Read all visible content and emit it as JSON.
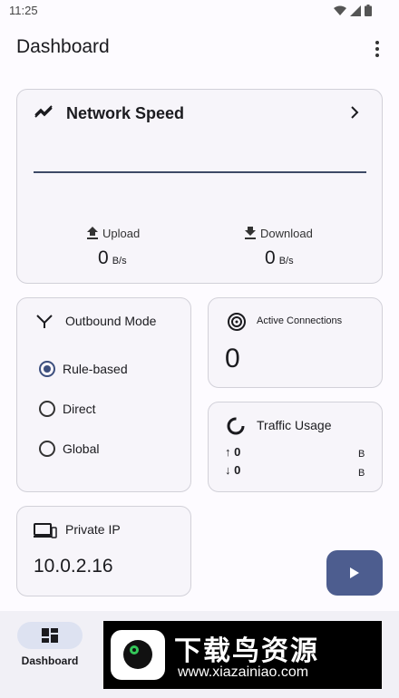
{
  "status": {
    "time": "11:25"
  },
  "appbar": {
    "title": "Dashboard"
  },
  "network_speed": {
    "title": "Network Speed",
    "upload_label": "Upload",
    "upload_value": "0",
    "upload_unit": "B/s",
    "download_label": "Download",
    "download_value": "0",
    "download_unit": "B/s"
  },
  "outbound": {
    "title": "Outbound Mode",
    "options": [
      "Rule-based",
      "Direct",
      "Global"
    ],
    "selected": "Rule-based"
  },
  "connections": {
    "title": "Active Connections",
    "value": "0"
  },
  "traffic": {
    "title": "Traffic Usage",
    "up_value": "0",
    "up_unit": "B",
    "down_value": "0",
    "down_unit": "B",
    "up_arrow": "↑",
    "down_arrow": "↓"
  },
  "private_ip": {
    "title": "Private IP",
    "value": "10.0.2.16"
  },
  "nav": {
    "dashboard_label": "Dashboard"
  },
  "banner": {
    "brand": "下载鸟资源",
    "url": "www.xiazainiao.com"
  },
  "colors": {
    "accent": "#4d5d8f",
    "card_bg": "#f7f5fa",
    "border": "#d2d1d9"
  }
}
